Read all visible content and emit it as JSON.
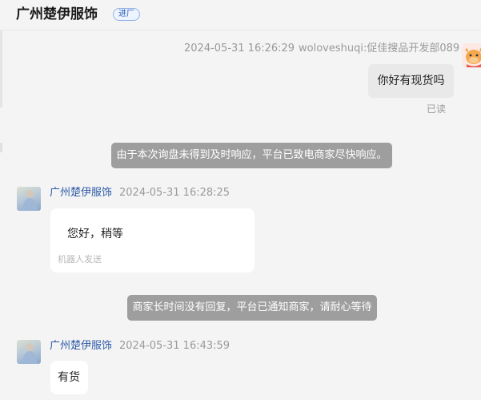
{
  "header": {
    "shop_name": "广州楚伊服饰",
    "badge": "进厂"
  },
  "messages": {
    "m1": {
      "time": "2024-05-31 16:26:29",
      "sender": "woloveshuqi:促佳搜品开发部089",
      "text": "你好有现货吗",
      "status": "已读"
    },
    "sys1": "由于本次询盘未得到及时响应，平台已致电商家尽快响应。",
    "m2": {
      "sender": "广州楚伊服饰",
      "time": "2024-05-31 16:28:25",
      "text": "您好，稍等",
      "note": "机器人发送"
    },
    "sys2": "商家长时间没有回复，平台已通知商家，请耐心等待",
    "m3": {
      "sender": "广州楚伊服饰",
      "time": "2024-05-31 16:43:59",
      "text": "有货"
    }
  },
  "colors": {
    "background": "#f4f4f4",
    "system_notice": "#9e9e9e",
    "sender_name": "#2d5aa8",
    "badge_border": "#8fb3e6"
  },
  "icons": {
    "self_avatar": "cartoon-cow-avatar",
    "shop_avatar": "shop-photo-avatar"
  }
}
